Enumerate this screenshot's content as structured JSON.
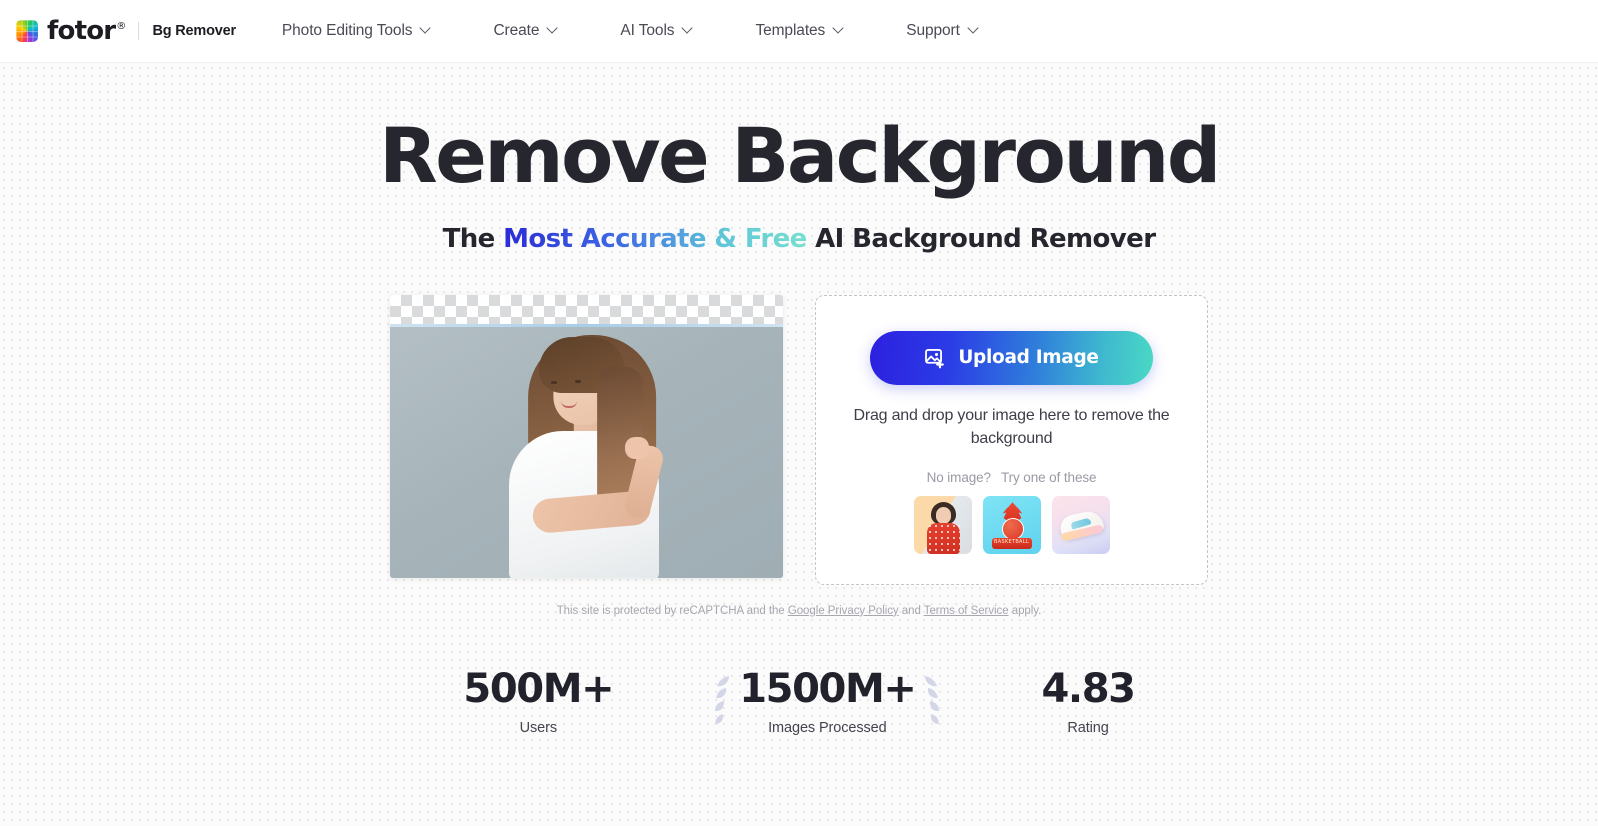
{
  "header": {
    "logo_text": "fotor",
    "logo_registered": "®",
    "logo_icon": "fotor-rainbow-grid-logo",
    "product_name": "Bg Remover",
    "nav_items": [
      {
        "label": "Photo Editing Tools",
        "icon": "chevron-down-icon"
      },
      {
        "label": "Create",
        "icon": "chevron-down-icon"
      },
      {
        "label": "AI Tools",
        "icon": "chevron-down-icon"
      },
      {
        "label": "Templates",
        "icon": "chevron-down-icon"
      },
      {
        "label": "Support",
        "icon": "chevron-down-icon"
      }
    ]
  },
  "hero": {
    "title": "Remove Background",
    "subtitle_prefix": "The ",
    "subtitle_gradient": "Most Accurate & Free",
    "subtitle_suffix": " AI Background Remover",
    "gradient_start": "#2b2bd6",
    "gradient_end": "#77e0cf"
  },
  "preview": {
    "name": "before-after-preview",
    "alt": "Woman with long brown hair in white t-shirt on grey-blue background, top band showing transparency checkerboard"
  },
  "upload": {
    "button_label": "Upload Image",
    "button_icon": "image-plus-icon",
    "button_gradient_start": "#2c20e0",
    "button_gradient_end": "#4ad9c4",
    "drop_text": "Drag and drop your image here to remove the background",
    "no_image_label": "No image?",
    "try_label": "Try one of these",
    "samples": [
      {
        "name": "sample-woman-red-dress",
        "alt": "Woman in red polka dot dress"
      },
      {
        "name": "sample-basketball-logo",
        "alt": "Basketball flame emblem with BASKETBALL ribbon"
      },
      {
        "name": "sample-sneaker",
        "alt": "Pastel sneaker on pink background"
      }
    ]
  },
  "recaptcha": {
    "text_before": "This site is protected by reCAPTCHA and the ",
    "privacy_link": "Google Privacy Policy",
    "text_middle": " and ",
    "terms_link": "Terms of Service",
    "text_after": " apply."
  },
  "stats": [
    {
      "value": "500M+",
      "label": "Users",
      "wreath": false
    },
    {
      "value": "1500M+",
      "label": "Images Processed",
      "wreath": true
    },
    {
      "value": "4.83",
      "label": "Rating",
      "wreath": false
    }
  ]
}
